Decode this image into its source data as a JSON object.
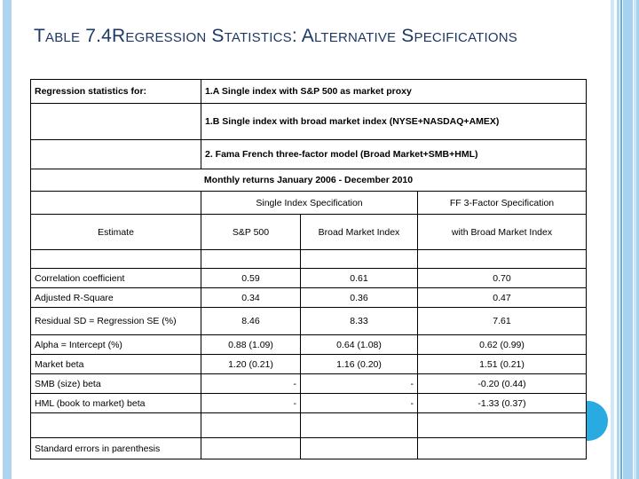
{
  "slide": {
    "title": "Table 7.4Regression Statistics: Alternative Specifications",
    "accent_blue": "#29ABE2",
    "header_fill": "#9DCFE8",
    "title_color": "#1F3864"
  },
  "table": {
    "spec_label": "Regression statistics for:",
    "specifications": [
      "1.A Single index with S&P 500 as market proxy",
      "1.B Single index with broad market index (NYSE+NASDAQ+AMEX)",
      "2. Fama French three-factor model (Broad Market+SMB+HML)"
    ],
    "period_note": "Monthly returns January 2006 - December 2010",
    "group_headers": {
      "single_index": "Single Index Specification",
      "ff_three_factor": "FF 3-Factor Specification"
    },
    "column_headers": [
      "Estimate",
      "S&P 500",
      "Broad Market Index",
      "with Broad Market Index"
    ],
    "rows": [
      {
        "label": "Correlation coefficient",
        "values": [
          "0.59",
          "0.61",
          "0.70"
        ]
      },
      {
        "label": "Adjusted R-Square",
        "values": [
          "0.34",
          "0.36",
          "0.47"
        ]
      },
      {
        "label": "Residual SD = Regression SE (%)",
        "values": [
          "8.46",
          "8.33",
          "7.61"
        ]
      },
      {
        "label": "Alpha = Intercept (%)",
        "values": [
          "0.88 (1.09)",
          "0.64 (1.08)",
          "0.62 (0.99)"
        ]
      },
      {
        "label": "Market beta",
        "values": [
          "1.20 (0.21)",
          "1.16 (0.20)",
          "1.51 (0.21)"
        ]
      },
      {
        "label": "SMB (size) beta",
        "values": [
          "-",
          "-",
          "-0.20 (0.44)"
        ]
      },
      {
        "label": "HML (book to market) beta",
        "values": [
          "-",
          "-",
          "-1.33 (0.37)"
        ]
      }
    ],
    "footnote": "Standard errors in parenthesis"
  }
}
